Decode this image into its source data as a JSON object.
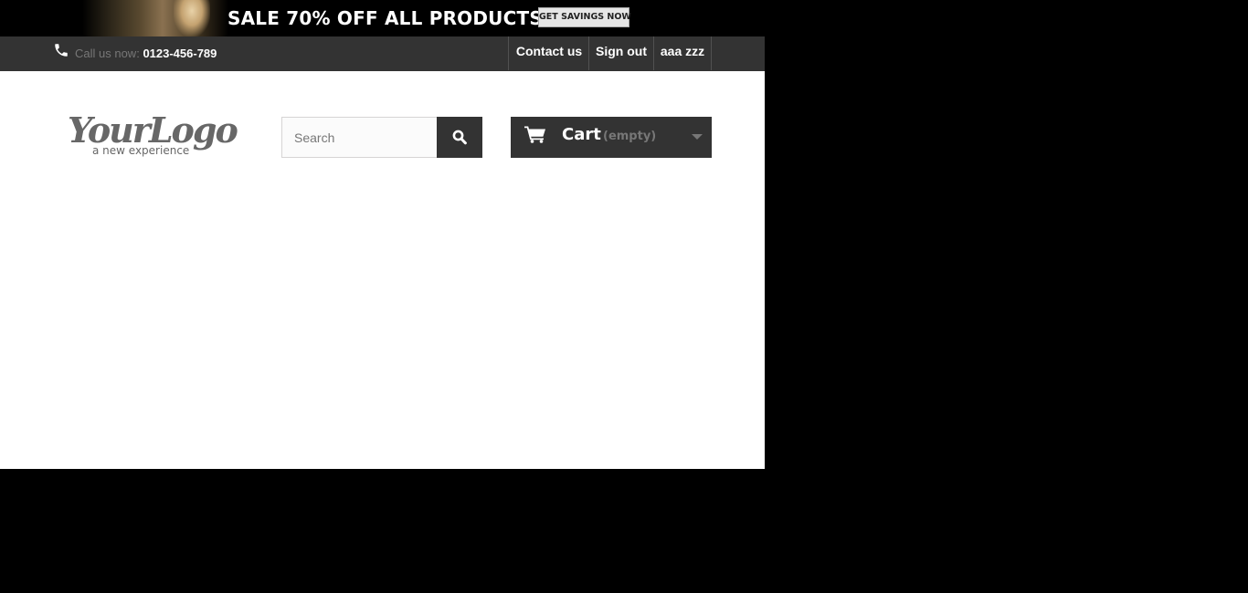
{
  "banner": {
    "headline": "SALE 70% OFF ALL PRODUCTS",
    "cta_label": "GET SAVINGS NOW"
  },
  "navbar": {
    "call_label": "Call us now:",
    "phone_number": "0123-456-789",
    "links": [
      {
        "label": "Contact us"
      },
      {
        "label": "Sign out"
      },
      {
        "label": "aaa zzz"
      }
    ]
  },
  "header": {
    "logo_text": "YourLogo",
    "logo_tagline": "a new experience",
    "search_placeholder": "Search",
    "cart_label": "Cart",
    "cart_status": "(empty)"
  },
  "icons": {
    "phone": "phone-icon",
    "search": "search-icon",
    "cart": "shopping-cart-icon",
    "caret": "caret-down-icon"
  },
  "colors": {
    "dark_bar": "#333333",
    "muted_text": "#777777",
    "white": "#ffffff",
    "logo_gray": "#676767"
  }
}
